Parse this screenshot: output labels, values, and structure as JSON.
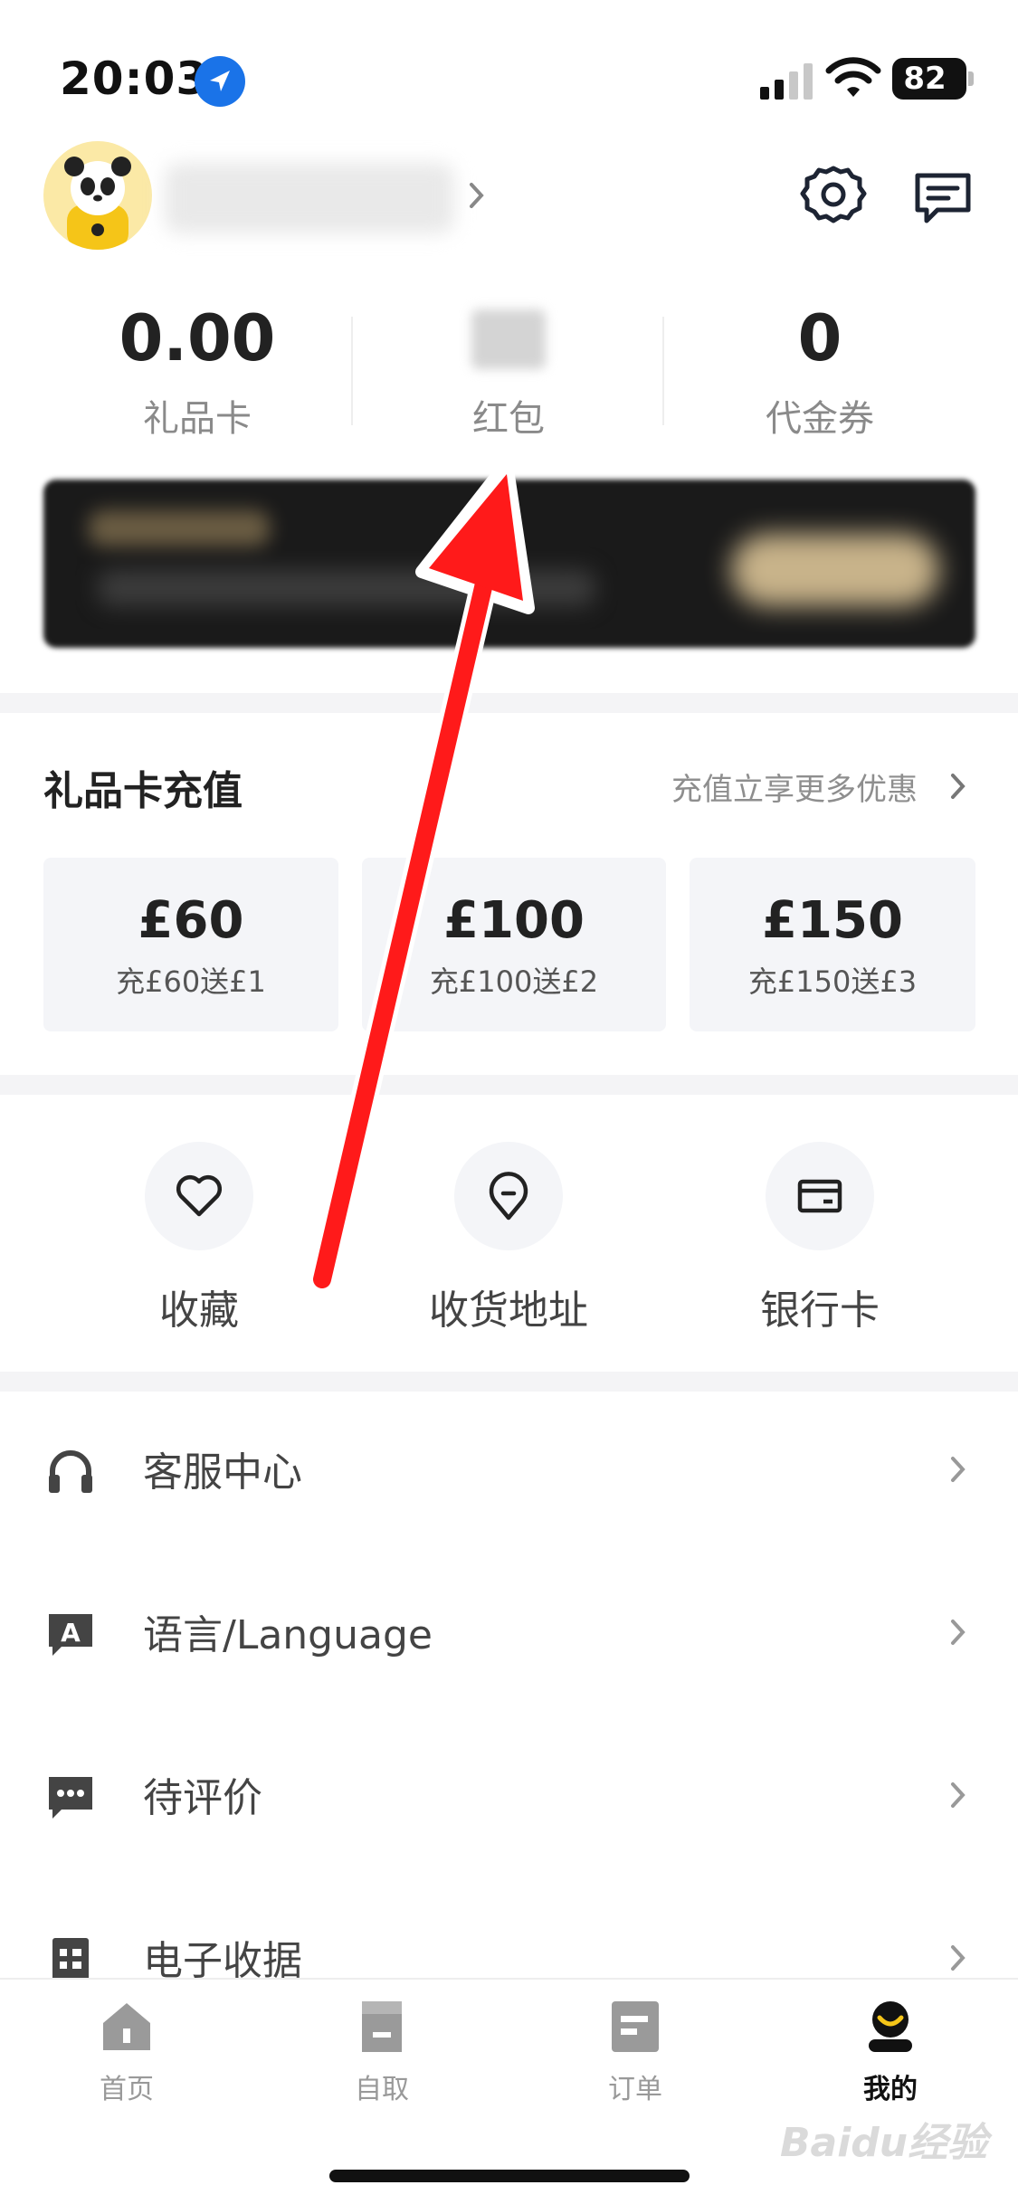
{
  "status_bar": {
    "time": "20:03",
    "battery": "82"
  },
  "profile": {
    "settings_icon": "gear-icon",
    "message_icon": "message-icon"
  },
  "stats": [
    {
      "value": "0.00",
      "label": "礼品卡"
    },
    {
      "value": "",
      "label": "红包"
    },
    {
      "value": "0",
      "label": "代金券"
    }
  ],
  "gift_card": {
    "title": "礼品卡充值",
    "link": "充值立享更多优惠",
    "options": [
      {
        "amount": "£60",
        "bonus": "充£60送£1"
      },
      {
        "amount": "£100",
        "bonus": "充£100送£2"
      },
      {
        "amount": "£150",
        "bonus": "充£150送£3"
      }
    ]
  },
  "quick_actions": [
    {
      "label": "收藏",
      "icon": "heart-icon"
    },
    {
      "label": "收货地址",
      "icon": "location-pin-icon"
    },
    {
      "label": "银行卡",
      "icon": "bank-card-icon"
    }
  ],
  "menu": [
    {
      "label": "客服中心",
      "icon": "headset-icon"
    },
    {
      "label": "语言/Language",
      "icon": "language-icon"
    },
    {
      "label": "待评价",
      "icon": "comment-icon"
    },
    {
      "label": "电子收据",
      "icon": "receipt-icon"
    }
  ],
  "tabs": [
    {
      "label": "首页",
      "icon": "home-icon",
      "active": false
    },
    {
      "label": "自取",
      "icon": "pickup-icon",
      "active": false
    },
    {
      "label": "订单",
      "icon": "order-icon",
      "active": false
    },
    {
      "label": "我的",
      "icon": "profile-icon",
      "active": true
    }
  ],
  "colors": {
    "accent_dark": "#222222",
    "muted_text": "#8a8a8a",
    "tile_bg": "#f4f5f8",
    "annotation_red": "#ff1a1a"
  },
  "watermark": "Baidu经验"
}
